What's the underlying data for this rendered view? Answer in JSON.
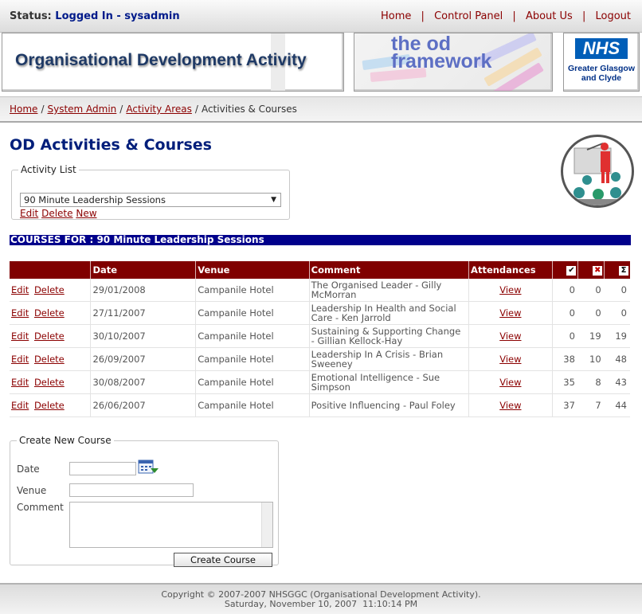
{
  "status": {
    "label": "Status:",
    "text": "Logged In - sysadmin"
  },
  "topnav": {
    "home": "Home",
    "control_panel": "Control Panel",
    "about": "About Us",
    "logout": "Logout",
    "separator": "|"
  },
  "banner": {
    "site_title": "Organisational Development Activity",
    "od_framework_text": "the od framework",
    "nhs_logo": "NHS",
    "nhs_subtitle_line1": "Greater Glasgow",
    "nhs_subtitle_line2": "and Clyde"
  },
  "breadcrumb": {
    "items": [
      "Home",
      "System Admin",
      "Activity Areas"
    ],
    "current": "Activities & Courses",
    "separator": "/"
  },
  "page_title": "OD Activities & Courses",
  "activity_list": {
    "legend": "Activity List",
    "selected": "90 Minute Leadership Sessions",
    "edit": "Edit",
    "delete": "Delete",
    "new": "New"
  },
  "courses_header": "COURSES FOR : 90 Minute Leadership Sessions",
  "table": {
    "headers": {
      "date": "Date",
      "venue": "Venue",
      "comment": "Comment",
      "attendances": "Attendances"
    },
    "header_icons": [
      "check-icon",
      "cross-icon",
      "sigma-icon"
    ],
    "edit_label": "Edit",
    "delete_label": "Delete",
    "view_label": "View",
    "rows": [
      {
        "date": "29/01/2008",
        "venue": "Campanile Hotel",
        "comment": "The Organised Leader - Gilly McMorran",
        "attended": "0",
        "absent": "0",
        "total": "0"
      },
      {
        "date": "27/11/2007",
        "venue": "Campanile Hotel",
        "comment": "Leadership In Health and Social Care - Ken Jarrold",
        "attended": "0",
        "absent": "0",
        "total": "0"
      },
      {
        "date": "30/10/2007",
        "venue": "Campanile Hotel",
        "comment": "Sustaining & Supporting Change - Gillian Kellock-Hay",
        "attended": "0",
        "absent": "19",
        "total": "19"
      },
      {
        "date": "26/09/2007",
        "venue": "Campanile Hotel",
        "comment": "Leadership In A Crisis - Brian Sweeney",
        "attended": "38",
        "absent": "10",
        "total": "48"
      },
      {
        "date": "30/08/2007",
        "venue": "Campanile Hotel",
        "comment": "Emotional Intelligence - Sue Simpson",
        "attended": "35",
        "absent": "8",
        "total": "43"
      },
      {
        "date": "26/06/2007",
        "venue": "Campanile Hotel",
        "comment": "Positive Influencing - Paul Foley",
        "attended": "37",
        "absent": "7",
        "total": "44"
      }
    ]
  },
  "create_course": {
    "legend": "Create New Course",
    "date_label": "Date",
    "venue_label": "Venue",
    "comment_label": "Comment",
    "date_value": "",
    "venue_value": "",
    "comment_value": "",
    "button": "Create Course"
  },
  "footer": {
    "copyright": "Copyright © 2007-2007 NHSGGC (Organisational Development Activity).",
    "datetime": "Saturday, November 10, 2007  11:10:14 PM"
  },
  "colors": {
    "header_red": "#800000",
    "navy": "#00008b",
    "title_blue": "#001e7a",
    "link_red": "#8b0000"
  }
}
